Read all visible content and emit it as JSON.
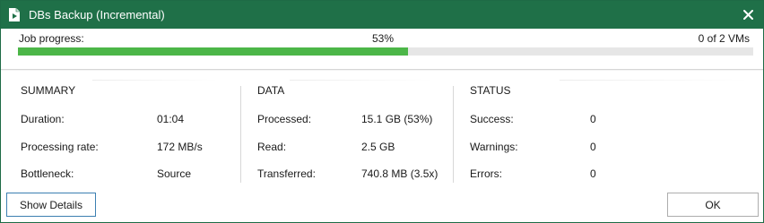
{
  "window": {
    "title": "DBs Backup (Incremental)",
    "icon": "veeam-job-icon",
    "close_icon": "close-icon",
    "accent_color": "#1f7048"
  },
  "progress": {
    "label": "Job progress:",
    "percent_text": "53%",
    "fraction": 0.53,
    "count_text": "0 of 2 VMs",
    "bar_color": "#4cb648"
  },
  "summary": {
    "heading": "SUMMARY",
    "rows": [
      {
        "label": "Duration:",
        "value": "01:04"
      },
      {
        "label": "Processing rate:",
        "value": "172 MB/s"
      },
      {
        "label": "Bottleneck:",
        "value": "Source"
      }
    ]
  },
  "data": {
    "heading": "DATA",
    "rows": [
      {
        "label": "Processed:",
        "value": "15.1 GB (53%)"
      },
      {
        "label": "Read:",
        "value": "2.5 GB"
      },
      {
        "label": "Transferred:",
        "value": "740.8 MB (3.5x)"
      }
    ]
  },
  "status": {
    "heading": "STATUS",
    "rows": [
      {
        "label": "Success:",
        "value": "0"
      },
      {
        "label": "Warnings:",
        "value": "0"
      },
      {
        "label": "Errors:",
        "value": "0"
      }
    ]
  },
  "footer": {
    "details_label": "Show Details",
    "ok_label": "OK"
  }
}
